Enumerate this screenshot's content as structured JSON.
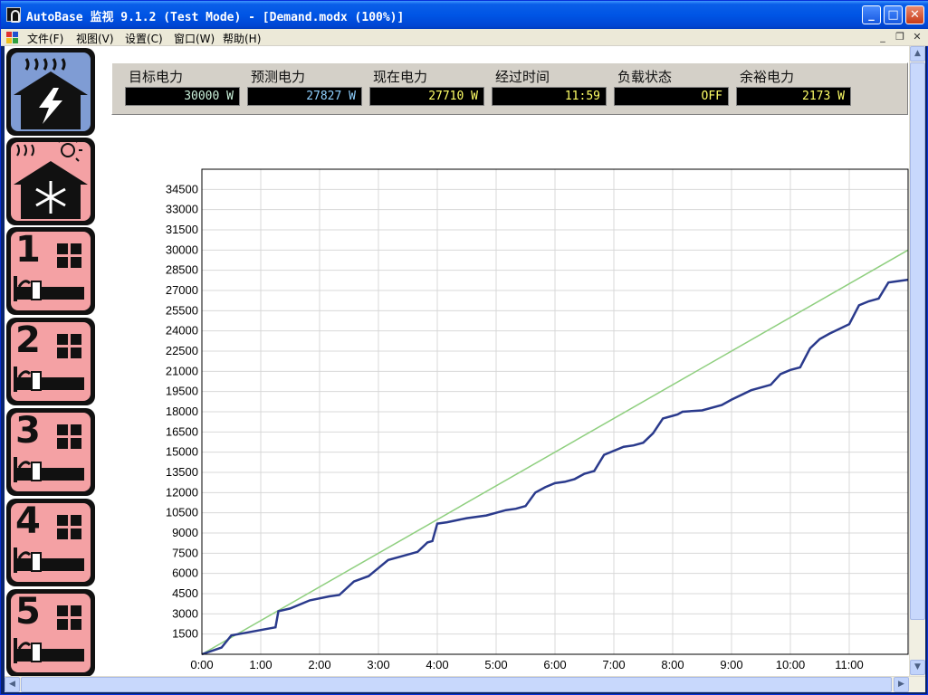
{
  "window": {
    "title": "AutoBase 监视 9.1.2 (Test Mode) - [Demand.modx (100%)]",
    "buttons": {
      "minimize": "_",
      "maximize": "□",
      "close": "✕"
    }
  },
  "menubar": {
    "items": [
      "文件(F)",
      "视图(V)",
      "设置(C)",
      "窗口(W)",
      "帮助(H)"
    ],
    "mdi": {
      "minimize": "_",
      "restore": "❐",
      "close": "✕"
    }
  },
  "sidebar": {
    "items": [
      {
        "icon": "house-power-icon",
        "label": "",
        "color": "#7f9cd4"
      },
      {
        "icon": "house-cooling-icon",
        "label": "",
        "color": "#f4a1a4"
      },
      {
        "icon": "room-icon",
        "label": "1",
        "color": "#f4a1a4"
      },
      {
        "icon": "room-icon",
        "label": "2",
        "color": "#f4a1a4"
      },
      {
        "icon": "room-icon",
        "label": "3",
        "color": "#f4a1a4"
      },
      {
        "icon": "room-icon",
        "label": "4",
        "color": "#f4a1a4"
      },
      {
        "icon": "room-icon",
        "label": "5",
        "color": "#f4a1a4"
      }
    ]
  },
  "metrics": [
    {
      "label": "目标电力",
      "value": "30000 W",
      "color": "#c9f0d9"
    },
    {
      "label": "预测电力",
      "value": "27827 W",
      "color": "#8fd0ff"
    },
    {
      "label": "现在电力",
      "value": "27710 W",
      "color": "#ffff66"
    },
    {
      "label": "经过时间",
      "value": "11:59",
      "color": "#ffff66"
    },
    {
      "label": "负载状态",
      "value": "OFF",
      "color": "#ffff66"
    },
    {
      "label": "余裕电力",
      "value": "2173 W",
      "color": "#ffff66"
    }
  ],
  "chart_data": {
    "type": "line",
    "title": "",
    "xlabel": "",
    "ylabel": "",
    "x_ticks": [
      "0:00",
      "1:00",
      "2:00",
      "3:00",
      "4:00",
      "5:00",
      "6:00",
      "7:00",
      "8:00",
      "9:00",
      "10:00",
      "11:00"
    ],
    "y_ticks": [
      1500,
      3000,
      4500,
      6000,
      7500,
      9000,
      10500,
      12000,
      13500,
      15000,
      16500,
      18000,
      19500,
      21000,
      22500,
      24000,
      25500,
      27000,
      28500,
      30000,
      31500,
      33000,
      34500
    ],
    "xlim_minutes": [
      0,
      720
    ],
    "ylim": [
      0,
      36000
    ],
    "grid": true,
    "colors": {
      "target": "#8fcf7f",
      "actual": "#2a3a8c"
    },
    "series": [
      {
        "role": "target",
        "x_minutes": [
          0,
          720
        ],
        "values": [
          0,
          30000
        ]
      },
      {
        "role": "actual",
        "x_minutes": [
          0,
          20,
          30,
          45,
          60,
          75,
          78,
          90,
          110,
          130,
          140,
          155,
          170,
          180,
          190,
          200,
          220,
          230,
          235,
          240,
          250,
          270,
          290,
          310,
          320,
          330,
          340,
          350,
          360,
          370,
          380,
          390,
          400,
          410,
          430,
          440,
          450,
          460,
          470,
          480,
          485,
          490,
          510,
          530,
          540,
          560,
          570,
          580,
          590,
          600,
          610,
          620,
          630,
          640,
          660,
          670,
          680,
          690,
          700,
          710,
          720
        ],
        "values": [
          0,
          500,
          1400,
          1600,
          1800,
          2000,
          3200,
          3400,
          4000,
          4300,
          4400,
          5400,
          5800,
          6400,
          7000,
          7200,
          7600,
          8300,
          8400,
          9700,
          9800,
          10100,
          10300,
          10700,
          10800,
          11000,
          12000,
          12400,
          12700,
          12800,
          13000,
          13400,
          13600,
          14800,
          15400,
          15500,
          15700,
          16400,
          17500,
          17700,
          17800,
          18000,
          18100,
          18500,
          18900,
          19600,
          19800,
          20000,
          20800,
          21100,
          21300,
          22700,
          23400,
          23800,
          24500,
          25900,
          26200,
          26400,
          27600,
          27700,
          27800
        ]
      }
    ]
  }
}
